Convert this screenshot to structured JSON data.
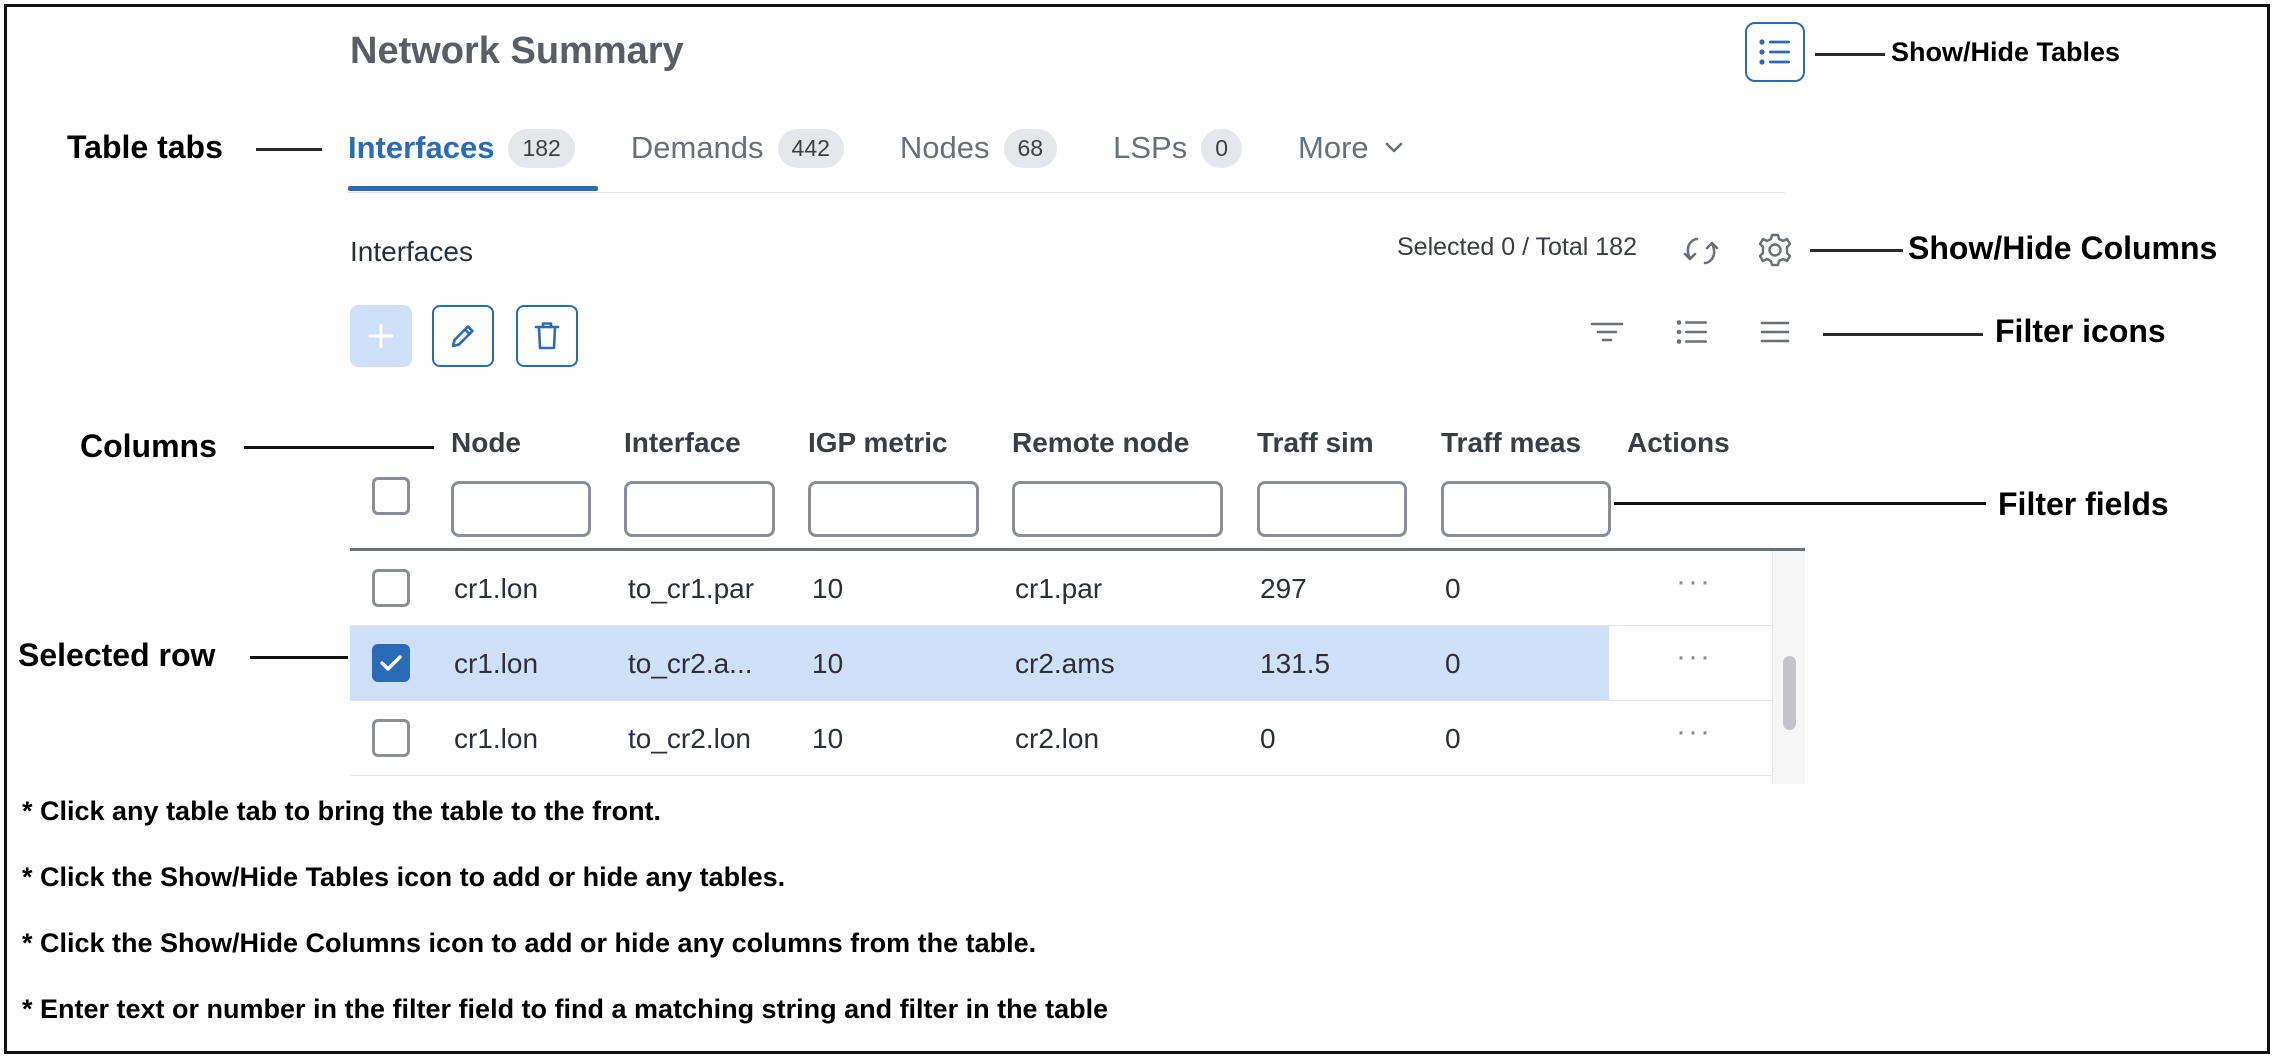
{
  "page_title": "Network Summary",
  "tabs": [
    {
      "label": "Interfaces",
      "count": "182"
    },
    {
      "label": "Demands",
      "count": "442"
    },
    {
      "label": "Nodes",
      "count": "68"
    },
    {
      "label": "LSPs",
      "count": "0"
    },
    {
      "label": "More",
      "count": ""
    }
  ],
  "section_label": "Interfaces",
  "selection_status": "Selected 0 / Total 182",
  "columns": [
    "Node",
    "Interface",
    "IGP metric",
    "Remote node",
    "Traff sim",
    "Traff meas",
    "Actions"
  ],
  "rows": [
    {
      "selected": false,
      "cells": [
        "cr1.lon",
        "to_cr1.par",
        "10",
        "cr1.par",
        "297",
        "0"
      ],
      "actions": "···"
    },
    {
      "selected": true,
      "cells": [
        "cr1.lon",
        "to_cr2.a...",
        "10",
        "cr2.ams",
        "131.5",
        "0"
      ],
      "actions": "···"
    },
    {
      "selected": false,
      "cells": [
        "cr1.lon",
        "to_cr2.lon",
        "10",
        "cr2.lon",
        "0",
        "0"
      ],
      "actions": "···"
    }
  ],
  "annotations": {
    "show_hide_tables": "Show/Hide Tables",
    "table_tabs": "Table tabs",
    "show_hide_columns": "Show/Hide Columns",
    "filter_icons": "Filter icons",
    "columns": "Columns",
    "filter_fields": "Filter fields",
    "selected_row": "Selected row"
  },
  "notes": [
    "* Click any table tab to bring the table to the front.",
    "* Click the Show/Hide Tables icon to add or hide any tables.",
    "* Click the Show/Hide Columns icon to add or hide any columns from the table.",
    "* Enter text or number in the filter field to find a matching string and filter in the table"
  ],
  "icons": {
    "show_hide_tables": "list-icon",
    "refresh": "refresh-icon",
    "settings": "gear-icon",
    "add": "plus-icon",
    "edit": "pencil-icon",
    "delete": "trash-icon",
    "filter": "filter-icon",
    "list_view": "list-icon",
    "compact_view": "menu-icon",
    "more": "chevron-down-icon"
  },
  "colors": {
    "accent": "#2a6bb6",
    "selected_row": "#cfe0fa",
    "add_button_disabled": "#cfe0fa"
  }
}
